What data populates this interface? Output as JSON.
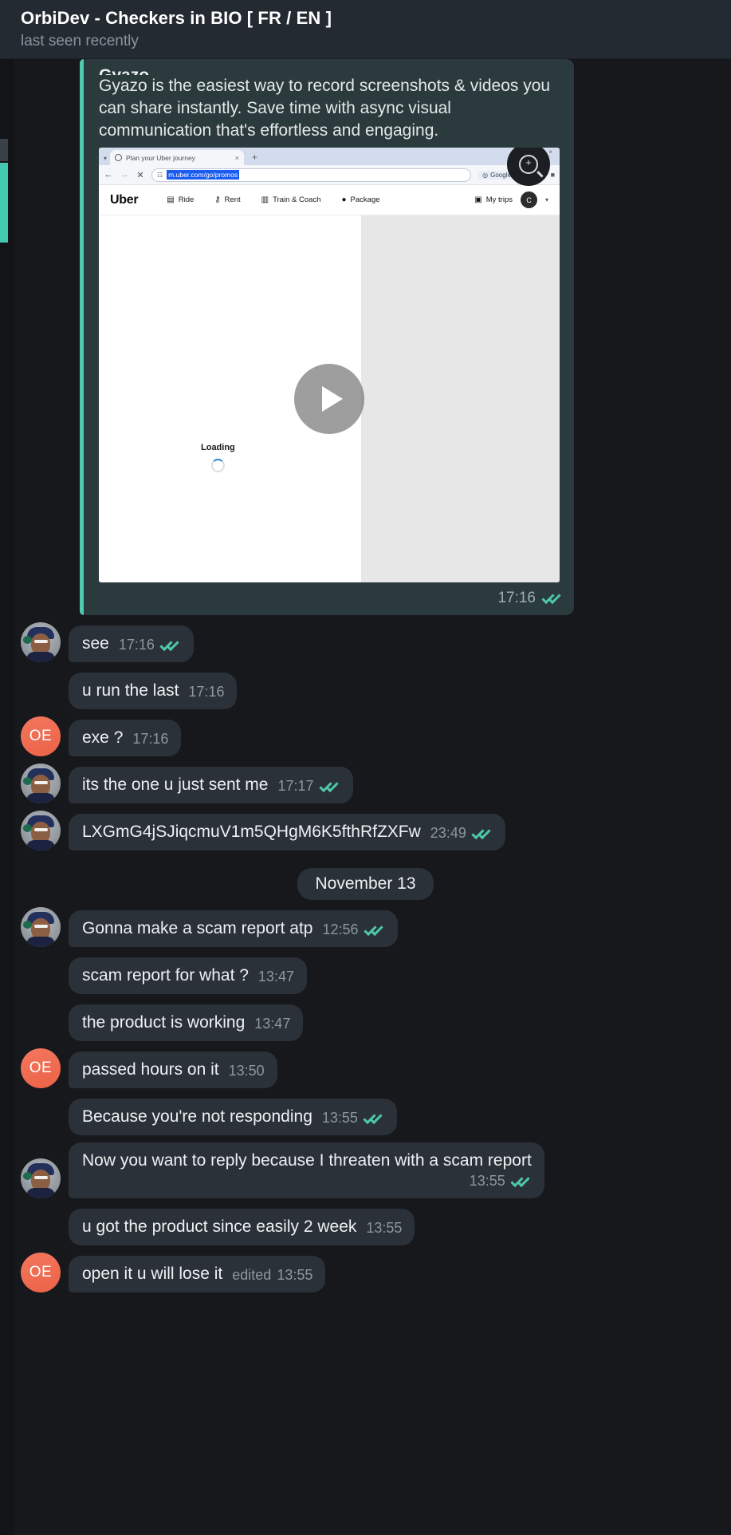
{
  "header": {
    "title": "OrbiDev - Checkers in BIO [ FR / EN ]",
    "status": "last seen recently"
  },
  "link_preview": {
    "site_title": "Gyazo",
    "description": "Gyazo is the easiest way to record screenshots & videos you can share instantly. Save time with async visual communication that's effortless and engaging.",
    "time": "17:16",
    "browser": {
      "tab_title": "Plan your Uber journey",
      "tab_close": "×",
      "new_tab": "+",
      "back": "←",
      "forward": "→",
      "stop": "✕",
      "url": "m.uber.com/go/promos",
      "lens_label": "Google Lens",
      "star": "☆",
      "brand": "Uber",
      "nav_items": [
        {
          "label": "Ride",
          "icon": "car-icon",
          "glyph": "▤"
        },
        {
          "label": "Rent",
          "icon": "key-icon",
          "glyph": "⚷"
        },
        {
          "label": "Train & Coach",
          "icon": "train-icon",
          "glyph": "▥"
        },
        {
          "label": "Package",
          "icon": "package-icon",
          "glyph": "●"
        }
      ],
      "my_trips": "My trips",
      "account_initial": "C",
      "caret": "▾",
      "loading_label": "Loading",
      "play": "play-button",
      "zoom_icon": "magnifier-plus-icon"
    }
  },
  "messages": [
    {
      "id": "m1",
      "avatar": "photo",
      "text": "see",
      "time": "17:16",
      "read": true,
      "multiline": false,
      "edited": null
    },
    {
      "id": "m2",
      "avatar": "none",
      "text": "u run the last",
      "time": "17:16",
      "read": false,
      "multiline": false,
      "edited": null
    },
    {
      "id": "m3",
      "avatar": "oe",
      "initials": "OE",
      "text": "exe ?",
      "time": "17:16",
      "read": false,
      "multiline": false,
      "edited": null
    },
    {
      "id": "m4",
      "avatar": "photo",
      "text": "its the one u just sent me",
      "time": "17:17",
      "read": true,
      "multiline": false,
      "edited": null
    },
    {
      "id": "m5",
      "avatar": "photo",
      "text": "LXGmG4jSJiqcmuV1m5QHgM6K5fthRfZXFw",
      "time": "23:49",
      "read": true,
      "multiline": false,
      "edited": null
    }
  ],
  "date_separator": "November 13",
  "messages_after": [
    {
      "id": "m6",
      "avatar": "photo",
      "text": "Gonna make a scam report atp",
      "time": "12:56",
      "read": true,
      "multiline": false,
      "edited": null
    },
    {
      "id": "m7",
      "avatar": "none",
      "text": "scam report for what ?",
      "time": "13:47",
      "read": false,
      "multiline": false,
      "edited": null
    },
    {
      "id": "m8",
      "avatar": "none",
      "text": "the product is working",
      "time": "13:47",
      "read": false,
      "multiline": false,
      "edited": null
    },
    {
      "id": "m9",
      "avatar": "oe",
      "initials": "OE",
      "text": "passed hours on it",
      "time": "13:50",
      "read": false,
      "multiline": false,
      "edited": null
    },
    {
      "id": "m10",
      "avatar": "none",
      "text": "Because you're not responding",
      "time": "13:55",
      "read": true,
      "multiline": false,
      "edited": null
    },
    {
      "id": "m11",
      "avatar": "photo",
      "text": "Now you want to reply because I threaten with a scam report",
      "time": "13:55",
      "read": true,
      "multiline": true,
      "edited": null
    },
    {
      "id": "m12",
      "avatar": "none",
      "text": "u got the product since easily 2 week",
      "time": "13:55",
      "read": false,
      "multiline": false,
      "edited": null
    },
    {
      "id": "m13",
      "avatar": "oe",
      "initials": "OE",
      "text": "open it u will lose it",
      "time": "13:55",
      "read": false,
      "multiline": false,
      "edited": "edited"
    }
  ],
  "colors": {
    "bg": "#17181c",
    "header_bg": "#242a31",
    "bubble_bg": "#2b3138",
    "preview_bg": "#2b3a3c",
    "accent_teal": "#4ecbb0",
    "tick_green": "#4ec9a8",
    "oe_avatar": "#ee6a4c",
    "time_text": "#8e979f"
  }
}
